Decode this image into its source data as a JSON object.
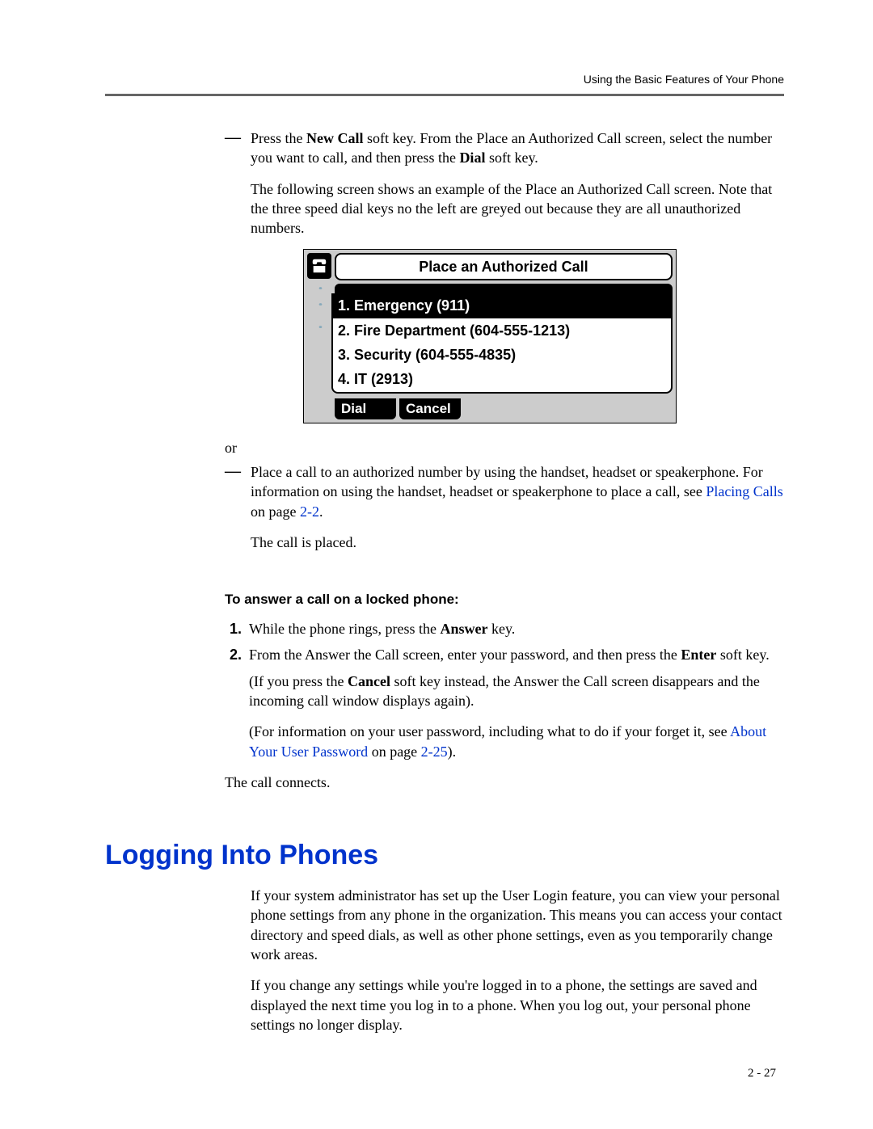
{
  "header": {
    "running_title": "Using the Basic Features of Your Phone"
  },
  "bullets": {
    "b1_pre": "Press the ",
    "b1_bold1": "New Call",
    "b1_mid": " soft key. From the Place an Authorized Call screen, select the number you want to call, and then press the ",
    "b1_bold2": "Dial",
    "b1_post": " soft key.",
    "b1_para2": "The following screen shows an example of the Place an Authorized Call screen. Note that the three speed dial keys no the left are greyed out because they are all unauthorized numbers.",
    "or_text": "or",
    "b2_pre": "Place a call to an authorized number by using the handset, headset or speakerphone. For information on using the handset, headset or speakerphone to place a call, see ",
    "b2_link": "Placing Calls",
    "b2_post": " on page ",
    "b2_pageref": "2-2",
    "b2_end": ".",
    "b2_result": "The call is placed."
  },
  "phone_screen": {
    "title": "Place an Authorized Call",
    "items": [
      "1. Emergency (911)",
      "2. Fire Department (604-555-1213)",
      "3. Security (604-555-4835)",
      "4. IT (2913)"
    ],
    "softkeys": {
      "dial": "Dial",
      "cancel": "Cancel"
    }
  },
  "answer": {
    "heading": "To answer a call on a locked phone:",
    "step1_pre": "While the phone rings, press the ",
    "step1_bold": "Answer",
    "step1_post": " key.",
    "step2_pre": "From the Answer the Call screen, enter your password, and then press the ",
    "step2_bold": "Enter",
    "step2_post": " soft key.",
    "step2_note1_pre": "(If you press the ",
    "step2_note1_bold": "Cancel",
    "step2_note1_post": " soft key instead, the Answer the Call screen disappears and the incoming call window displays again).",
    "step2_note2_pre": "(For information on your user password, including what to do if your forget it, see ",
    "step2_note2_link": "About Your User Password",
    "step2_note2_mid": " on page ",
    "step2_note2_pageref": "2-25",
    "step2_note2_end": ").",
    "result": "The call connects."
  },
  "section": {
    "title": "Logging Into Phones",
    "p1": "If your system administrator has set up the User Login feature, you can view your personal phone settings from any phone in the organization. This means you can access your contact directory and speed dials, as well as other phone settings, even as you temporarily change work areas.",
    "p2": "If you change any settings while you're logged in to a phone, the settings are saved and displayed the next time you log in to a phone. When you log out, your personal phone settings no longer display."
  },
  "page_number": "2 - 27"
}
